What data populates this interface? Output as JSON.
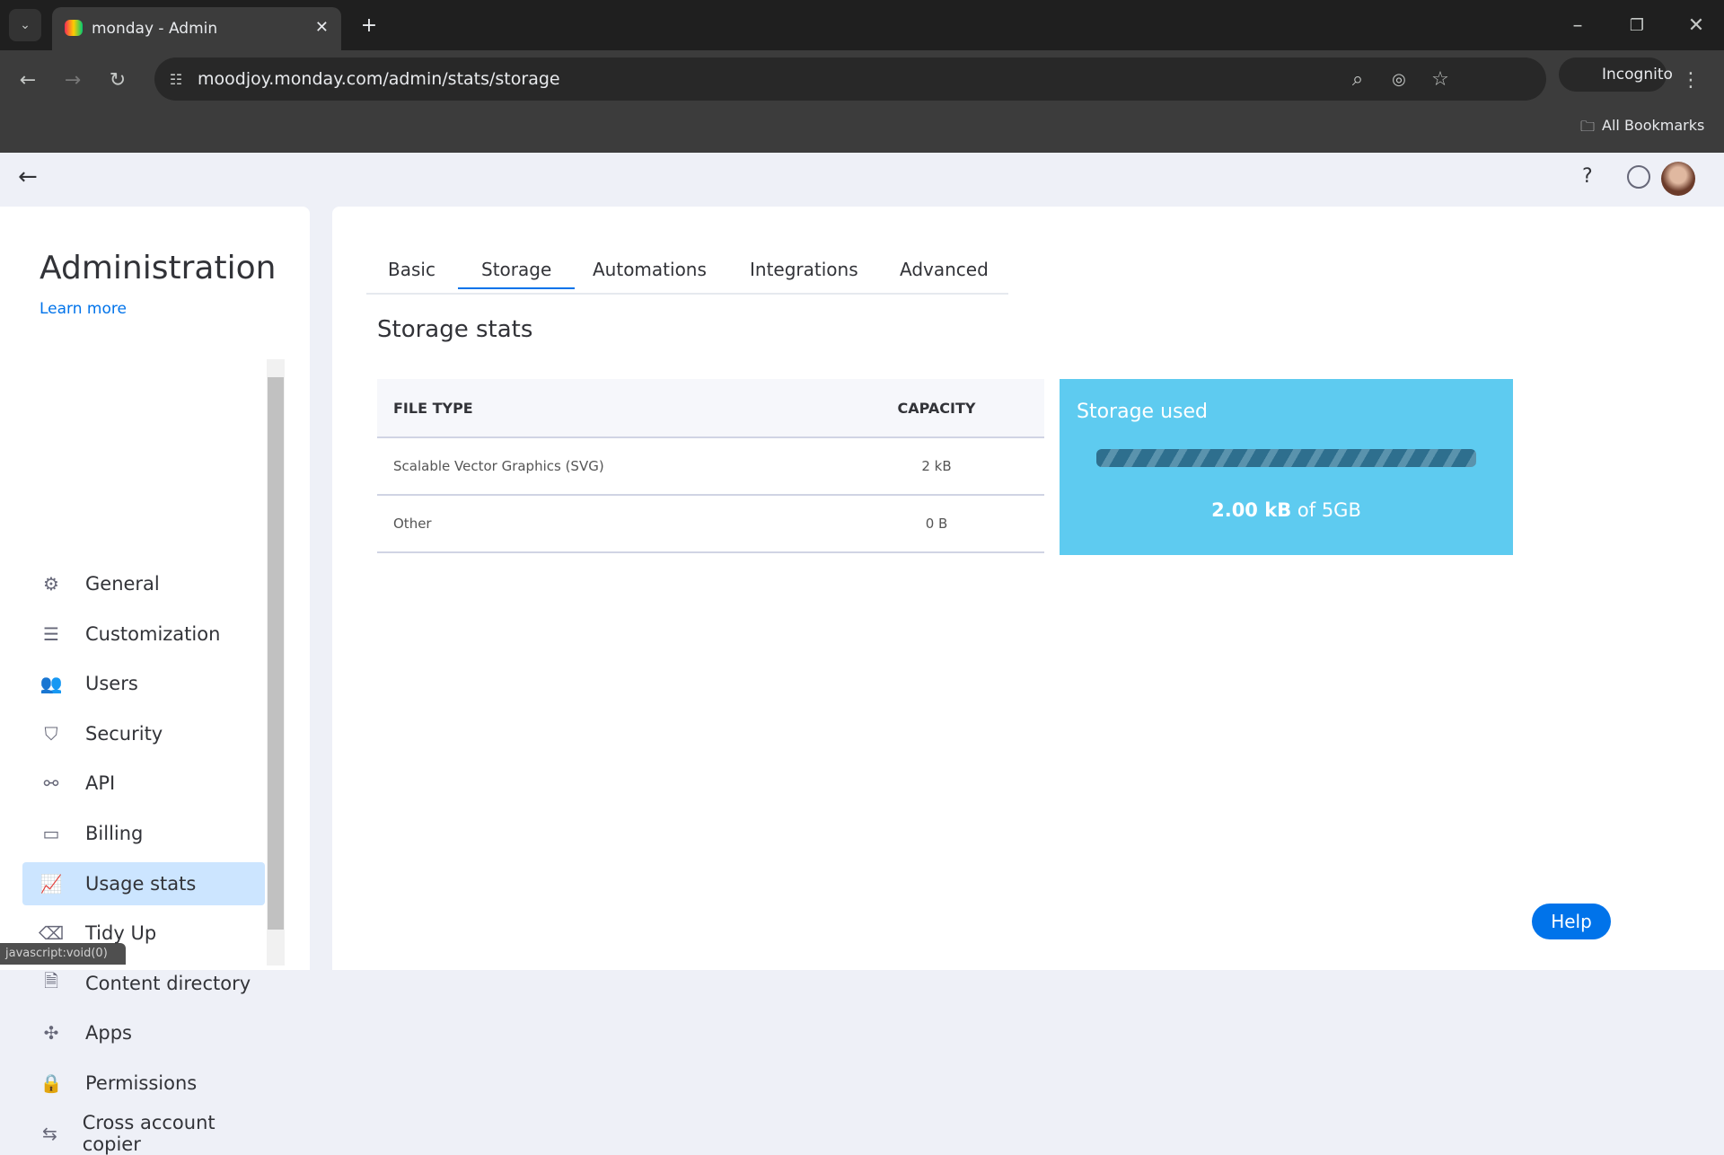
{
  "browser": {
    "tab_title": "monday - Admin",
    "url": "moodjoy.monday.com/admin/stats/storage",
    "incognito_label": "Incognito",
    "bookmarks_label": "All Bookmarks",
    "status_text": "javascript:void(0)"
  },
  "sidebar": {
    "title": "Administration",
    "learn_more": "Learn more",
    "items": [
      {
        "label": "General",
        "icon": "gear-icon"
      },
      {
        "label": "Customization",
        "icon": "sliders-icon"
      },
      {
        "label": "Users",
        "icon": "users-icon"
      },
      {
        "label": "Security",
        "icon": "shield-icon"
      },
      {
        "label": "API",
        "icon": "api-icon"
      },
      {
        "label": "Billing",
        "icon": "card-icon"
      },
      {
        "label": "Usage stats",
        "icon": "chart-icon",
        "active": true
      },
      {
        "label": "Tidy Up",
        "icon": "broom-icon"
      },
      {
        "label": "Content directory",
        "icon": "directory-icon"
      },
      {
        "label": "Apps",
        "icon": "puzzle-icon"
      },
      {
        "label": "Permissions",
        "icon": "lock-icon"
      },
      {
        "label": "Cross account copier",
        "icon": "transfer-icon"
      }
    ]
  },
  "tabs": [
    {
      "label": "Basic"
    },
    {
      "label": "Storage",
      "active": true
    },
    {
      "label": "Automations"
    },
    {
      "label": "Integrations"
    },
    {
      "label": "Advanced"
    }
  ],
  "section_title": "Storage stats",
  "table": {
    "headers": [
      "FILE TYPE",
      "CAPACITY"
    ],
    "rows": [
      {
        "type": "Scalable Vector Graphics (SVG)",
        "capacity": "2 kB"
      },
      {
        "type": "Other",
        "capacity": "0 B"
      }
    ]
  },
  "storage": {
    "title": "Storage used",
    "used": "2.00 kB",
    "of_text": "of 5GB",
    "used_fraction": 4e-07,
    "card_color": "#5ecbf0"
  },
  "help_label": "Help",
  "colors": {
    "accent": "#0073ea",
    "active_bg": "#cce5ff"
  }
}
